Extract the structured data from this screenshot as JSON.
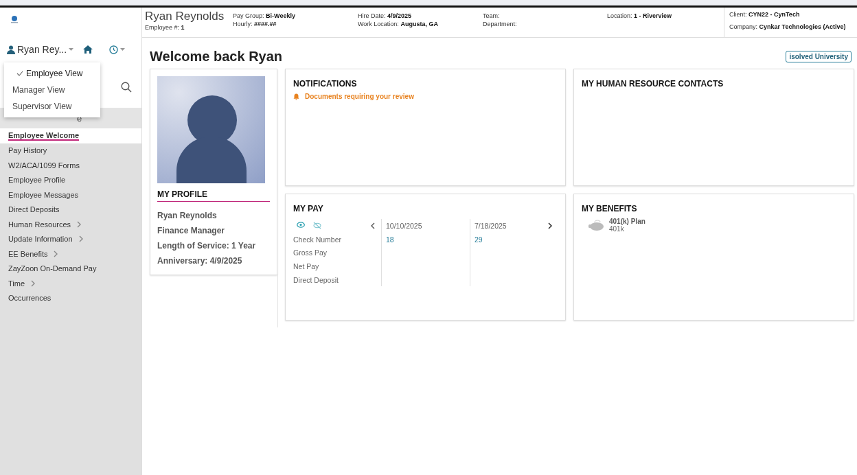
{
  "header": {
    "name": "Ryan Reynolds",
    "columns": [
      {
        "rows": [
          {
            "label": "Employee #:",
            "value": "1"
          }
        ]
      },
      {
        "rows": [
          {
            "label": "Pay Group:",
            "value": "Bi-Weekly"
          },
          {
            "label": "Hourly:",
            "value": "####.##"
          }
        ]
      },
      {
        "rows": [
          {
            "label": "Hire Date:",
            "value": "4/9/2025"
          },
          {
            "label": "Work Location:",
            "value": "Augusta, GA"
          }
        ]
      },
      {
        "rows": [
          {
            "label": "Team:"
          },
          {
            "label": "Department:"
          }
        ]
      },
      {
        "rows": [
          {
            "label": "Location:",
            "value": "1 - Riverview"
          }
        ]
      }
    ],
    "client": [
      {
        "label": "Client:",
        "value": "CYN22 - CynTech"
      },
      {
        "label": "Company:",
        "value": "Cynkar Technologies (Active)"
      }
    ]
  },
  "sidebar": {
    "user": "Ryan Rey...",
    "view_menu": [
      {
        "label": "Employee View",
        "selected": true
      },
      {
        "label": "Manager View",
        "selected": false
      },
      {
        "label": "Supervisor View",
        "selected": false
      }
    ],
    "covered_row_text": "e",
    "nav": [
      {
        "label": "Employee Welcome",
        "selected": true,
        "has_children": false
      },
      {
        "label": "Pay History",
        "selected": false,
        "has_children": false
      },
      {
        "label": "W2/ACA/1099 Forms",
        "selected": false,
        "has_children": false
      },
      {
        "label": "Employee Profile",
        "selected": false,
        "has_children": false
      },
      {
        "label": "Employee Messages",
        "selected": false,
        "has_children": false
      },
      {
        "label": "Direct Deposits",
        "selected": false,
        "has_children": false
      },
      {
        "label": "Human Resources",
        "selected": false,
        "has_children": true
      },
      {
        "label": "Update Information",
        "selected": false,
        "has_children": true
      },
      {
        "label": "EE Benefits",
        "selected": false,
        "has_children": true
      },
      {
        "label": "ZayZoon On-Demand Pay",
        "selected": false,
        "has_children": false
      },
      {
        "label": "Time",
        "selected": false,
        "has_children": true
      },
      {
        "label": "Occurrences",
        "selected": false,
        "has_children": false
      }
    ]
  },
  "main": {
    "title": "Welcome back Ryan",
    "university_link": "isolved University",
    "profile": {
      "title": "MY PROFILE",
      "lines": [
        "Ryan Reynolds",
        "Finance Manager",
        "Length of Service: 1 Year",
        "Anniversary: 4/9/2025"
      ]
    },
    "notifications": {
      "title": "NOTIFICATIONS",
      "items": [
        "Documents requiring your review"
      ]
    },
    "contacts": {
      "title": "MY HUMAN RESOURCE CONTACTS"
    },
    "pay": {
      "title": "MY PAY",
      "row_labels": [
        "Check Number",
        "Gross Pay",
        "Net Pay",
        "Direct Deposit"
      ],
      "checks": [
        {
          "date": "10/10/2025",
          "check_number": "18"
        },
        {
          "date": "7/18/2025",
          "check_number": "29"
        }
      ]
    },
    "benefits": {
      "title": "MY BENEFITS",
      "items": [
        {
          "name": "401(k) Plan",
          "type": "401k"
        }
      ]
    }
  }
}
